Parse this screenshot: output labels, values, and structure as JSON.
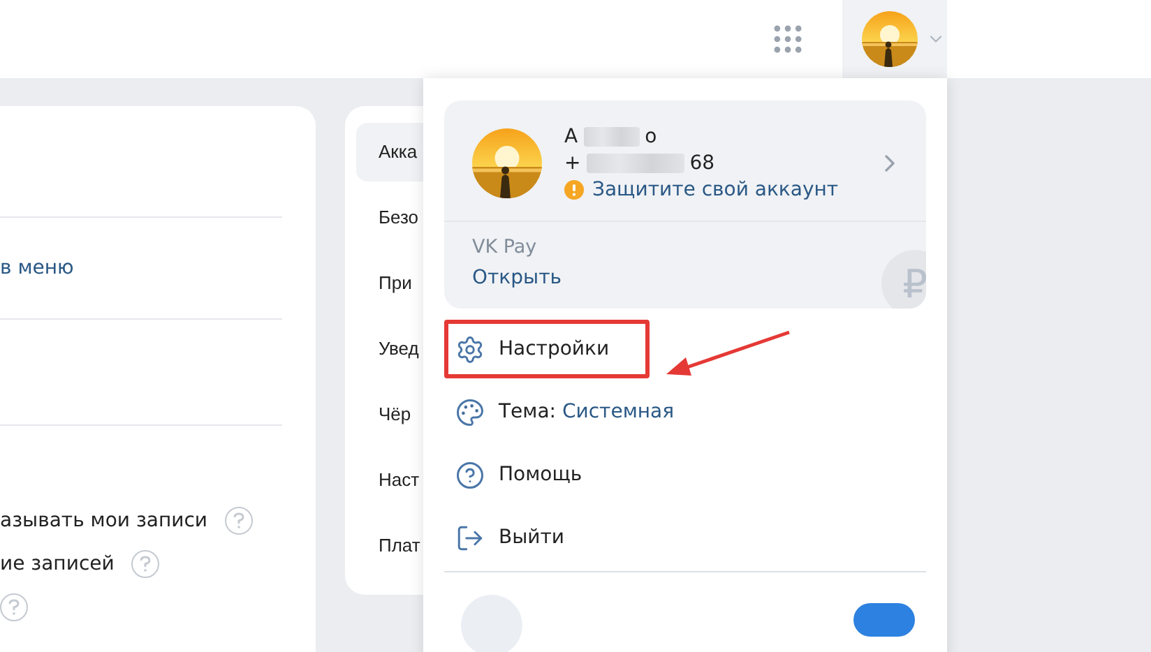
{
  "left_panel": {
    "link": "в меню",
    "help_rows": [
      {
        "kind": "text",
        "label": "азывать мои записи"
      },
      {
        "kind": "text",
        "label": "ие записей"
      },
      {
        "kind": "icon_only"
      }
    ]
  },
  "settings_nav": [
    {
      "label": "Акка",
      "selected": true
    },
    {
      "label": "Безо",
      "selected": false
    },
    {
      "label": "При",
      "selected": false
    },
    {
      "label": "Увед",
      "selected": false
    },
    {
      "label": "Чёр",
      "selected": false
    },
    {
      "label": "Наст",
      "selected": false
    },
    {
      "label": "Плат",
      "selected": false
    }
  ],
  "account_menu": {
    "profile": {
      "name_start": "А",
      "name_end": "о",
      "phone_start": "+",
      "phone_end": "68",
      "warning": "Защитите свой аккаунт"
    },
    "pay": {
      "title": "VK Pay",
      "action": "Открыть",
      "currency": "₽"
    },
    "toggle": {
      "on": true
    },
    "items": [
      {
        "kind": "settings",
        "label": "Настройки",
        "highlighted": true
      },
      {
        "kind": "theme",
        "label": "Тема:",
        "value": "Системная",
        "highlighted": false
      },
      {
        "kind": "help",
        "label": "Помощь",
        "highlighted": false
      },
      {
        "kind": "logout",
        "label": "Выйти",
        "highlighted": false
      }
    ]
  }
}
